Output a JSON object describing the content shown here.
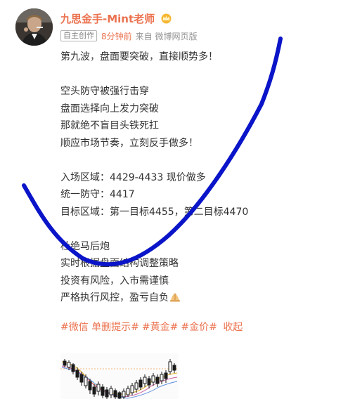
{
  "post": {
    "author": {
      "name": "九思金手-Mint老师",
      "badge_icon": "crown-icon"
    },
    "meta": {
      "original_tag": "自主创作",
      "time": "8分钟前",
      "source": "来自 微博网页版"
    },
    "content": {
      "lines": [
        "第九波，盘面要突破，直接顺势多！",
        "",
        "空头防守被强行击穿",
        "盘面选择向上发力突破",
        "那就绝不盲目头铁死扛",
        "顺应市场节奏，立刻反手做多！",
        "",
        "入场区域：4429-4433 现价做多",
        "统一防守：4417",
        "目标区域：第一目标4455，第二目标4470",
        "",
        "杜绝马后炮",
        "实时根据盘面结构调整策略",
        "投资有风险，入市需谨慎",
        "严格执行风控，盈亏自负"
      ],
      "closing_emoji_icon": "folded-hands-icon"
    },
    "tags": [
      "#微信 单删提示#",
      "#黄金#",
      "#金价#"
    ],
    "collapse_label": "收起",
    "image_icon": "candlestick-chart-thumbnail",
    "colors": {
      "accent": "#eb7350",
      "text": "#333333",
      "meta": "#939393",
      "annotation": "#0a14c8"
    }
  }
}
